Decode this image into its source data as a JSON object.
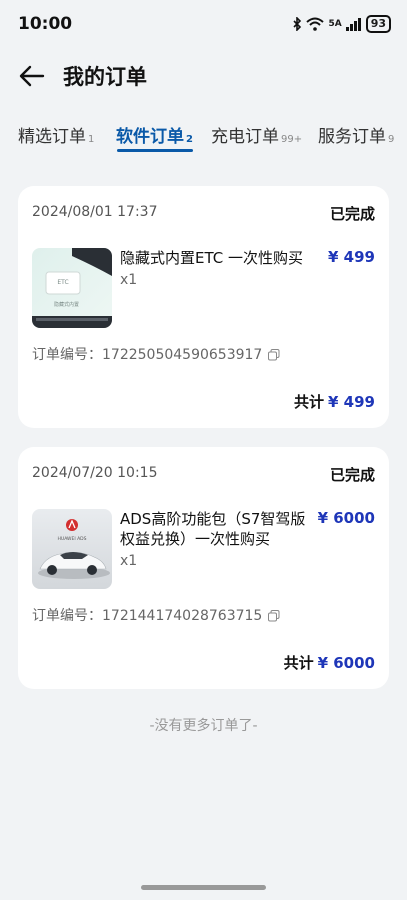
{
  "status_bar": {
    "time": "10:00",
    "network": "5A",
    "battery": "93"
  },
  "header": {
    "title": "我的订单"
  },
  "tabs": [
    {
      "label": "精选订单",
      "count": "1"
    },
    {
      "label": "软件订单",
      "count": "2"
    },
    {
      "label": "充电订单",
      "count": "99+"
    },
    {
      "label": "服务订单",
      "count": "9"
    }
  ],
  "orders": [
    {
      "date": "2024/08/01 17:37",
      "status": "已完成",
      "product": "隐藏式内置ETC 一次性购买",
      "qty": "x1",
      "price": "¥ 499",
      "order_label": "订单编号：",
      "order_no": "172250504590653917",
      "total_label": "共计",
      "total": "¥ 499",
      "thumb_text_1": "ETC",
      "thumb_text_2": "隐藏式内置"
    },
    {
      "date": "2024/07/20 10:15",
      "status": "已完成",
      "product": "ADS高阶功能包（S7智驾版权益兑换）一次性购买",
      "qty": "x1",
      "price": "¥ 6000",
      "order_label": "订单编号：",
      "order_no": "172144174028763715",
      "total_label": "共计",
      "total": "¥ 6000",
      "thumb_text_1": "HUAWEI ADS"
    }
  ],
  "footer": {
    "no_more": "-没有更多订单了-"
  },
  "colors": {
    "accent": "#0a59a8",
    "price": "#1e36b8",
    "background": "#f1f3f5"
  }
}
